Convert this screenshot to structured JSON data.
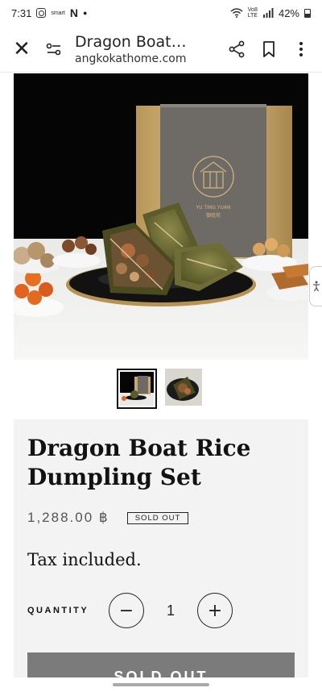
{
  "status_bar": {
    "time": "7:31",
    "app_label": "smart",
    "app_letter": "N",
    "network_top": "Vo8",
    "network_bottom": "LTE",
    "battery": "42%"
  },
  "toolbar": {
    "title": "Dragon Boat…",
    "url": "angkokathome.com"
  },
  "icons": {
    "close": "close-icon",
    "site_settings": "site-settings-icon",
    "share": "share-icon",
    "bookmark": "bookmark-icon",
    "menu": "more-vert-icon"
  },
  "hero": {
    "box_brand": "YU TING YUAN",
    "box_brand_cn": "御庭苑"
  },
  "product": {
    "title": "Dragon Boat Rice Dumpling Set",
    "price": "1,288.00 ฿",
    "badge": "SOLD OUT",
    "tax_note": "Tax included.",
    "quantity_label": "QUANTITY",
    "quantity_value": "1",
    "minus": "−",
    "plus": "+",
    "button_label": "SOLD OUT"
  },
  "colors": {
    "card_bg": "#f3f3f3",
    "button_bg": "#7b7b7b",
    "box_gold": "#c8a96a",
    "box_grey": "#6e6a66"
  }
}
